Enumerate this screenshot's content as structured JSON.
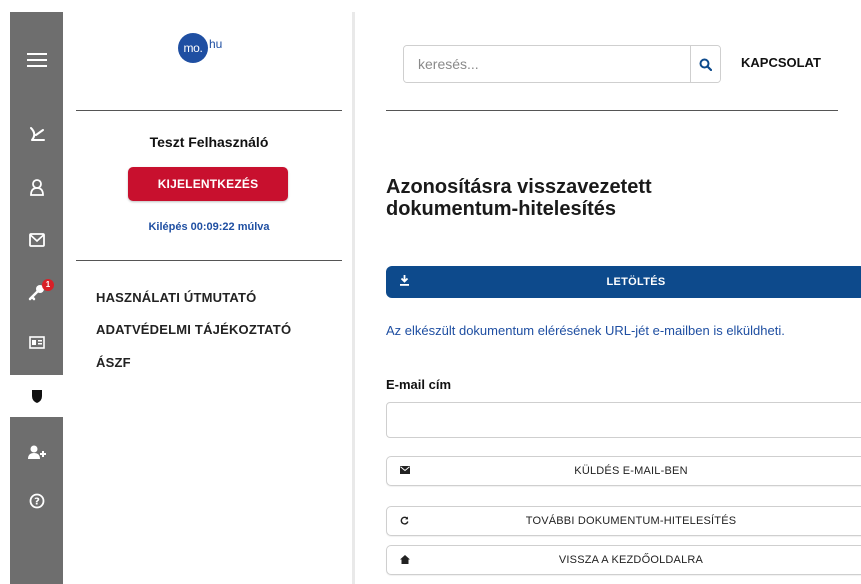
{
  "colors": {
    "sidebar": "#6e6e6e",
    "brand_blue": "#1f4fa2",
    "logout_red": "#c8102e",
    "download_blue": "#0d4a8c",
    "badge_red": "#d92027"
  },
  "sidebar": {
    "icons": [
      {
        "name": "menu-icon"
      },
      {
        "name": "signature-icon"
      },
      {
        "name": "user-icon"
      },
      {
        "name": "mail-icon"
      },
      {
        "name": "key-icon",
        "badge": "1"
      },
      {
        "name": "id-card-icon"
      },
      {
        "name": "shield-icon",
        "active": true
      },
      {
        "name": "add-user-icon"
      },
      {
        "name": "help-icon"
      }
    ]
  },
  "user_panel": {
    "logo": {
      "circle_text": "mo.",
      "rest_text": "hu"
    },
    "username": "Teszt Felhasználó",
    "logout_label": "KIJELENTKEZÉS",
    "countdown": "Kilépés 00:09:22 múlva",
    "links": [
      "HASZNÁLATI ÚTMUTATÓ",
      "ADATVÉDELMI TÁJÉKOZTATÓ",
      "ÁSZF"
    ]
  },
  "header": {
    "search_placeholder": "keresés...",
    "contact_label": "KAPCSOLAT"
  },
  "main": {
    "title_line1": "Azonosításra visszavezetett",
    "title_line2": "dokumentum-hitelesítés",
    "download_label": "LETÖLTÉS",
    "info_text": "Az elkészült dokumentum elérésének URL-jét e-mailben is elküldheti.",
    "email_label": "E-mail cím",
    "email_value": "",
    "send_label": "KÜLDÉS E-MAIL-BEN",
    "another_label": "TOVÁBBI DOKUMENTUM-HITELESÍTÉS",
    "home_label": "VISSZA A KEZDŐOLDALRA"
  }
}
